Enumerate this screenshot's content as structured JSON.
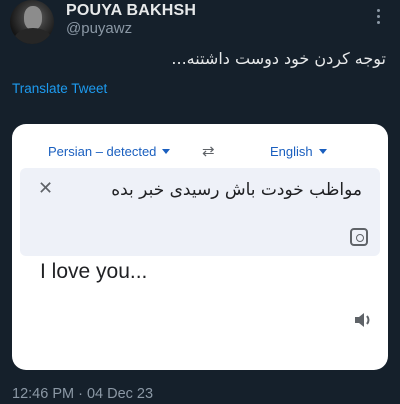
{
  "tweet": {
    "display_name": "POUYA BAKHSH",
    "handle": "@puyawz",
    "text": "توجه کردن خود دوست داشتنه...",
    "translate_link": "Translate Tweet",
    "timestamp": "12:46 PM · 04 Dec 23"
  },
  "media": {
    "source_language": "Persian – detected",
    "target_language": "English",
    "swap_icon": "⇄",
    "close_icon": "✕",
    "source_text": "مواظب خودت باش رسیدی خبر بده",
    "translated_text": "I love you..."
  },
  "colors": {
    "background": "#15202b",
    "link": "#1d9bf0",
    "muted": "#8b98a5",
    "translate_blue": "#1a5fbf"
  }
}
